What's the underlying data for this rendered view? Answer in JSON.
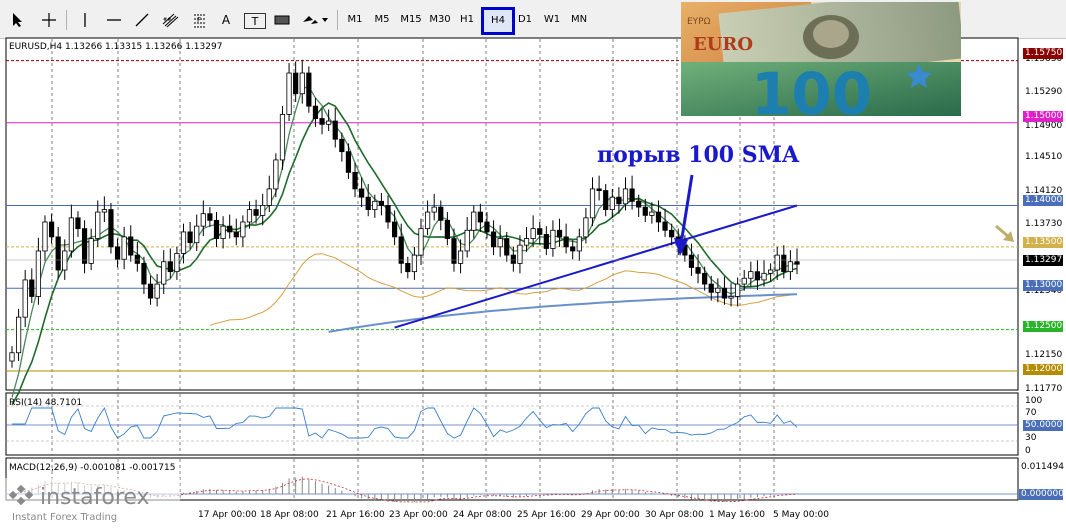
{
  "toolbar": {
    "timeframes": [
      "M1",
      "M5",
      "M15",
      "M30",
      "H1",
      "H4",
      "D1",
      "W1",
      "MN"
    ],
    "active_timeframe": "H4",
    "tools": [
      "cursor-tool",
      "crosshair-tool",
      "vertical-line-tool",
      "horizontal-line-tool",
      "trendline-tool",
      "channel-tool",
      "fibonacci-tool",
      "text-tool",
      "text-label-tool",
      "rectangle-tool",
      "shapes-dropdown"
    ],
    "text_tool_label": "A",
    "text_label_tool_label": "T"
  },
  "chart": {
    "title": "EURUSD,H4  1.13266 1.13315 1.13266 1.13297",
    "annotation": "порыв 100 SMA",
    "current_price": "1.13297",
    "price_axis_labels": [
      "1.15830",
      "1.15290",
      "1.14900",
      "1.14510",
      "1.14120",
      "1.13730",
      "1.12540",
      "1.12150",
      "1.11770"
    ],
    "level_labels": [
      {
        "value": "1.15750",
        "color": "#8b0000"
      },
      {
        "value": "1.15000",
        "color": "#e020c8"
      },
      {
        "value": "1.14000",
        "color": "#4a6fb8"
      },
      {
        "value": "1.13500",
        "color": "#d4b04a"
      },
      {
        "value": "1.13000",
        "color": "#4a6fb8"
      },
      {
        "value": "1.12500",
        "color": "#28b428"
      },
      {
        "value": "1.12000",
        "color": "#b48c00"
      }
    ],
    "time_labels": [
      "17 Apr 00:00",
      "18 Apr 08:00",
      "21 Apr 16:00",
      "23 Apr 00:00",
      "24 Apr 08:00",
      "25 Apr 16:00",
      "29 Apr 00:00",
      "30 Apr 08:00",
      "1 May 16:00",
      "5 May 00:00"
    ],
    "colors": {
      "bull": "#ffffff",
      "bear": "#000000",
      "sma100": "#1a1acc",
      "ma_fast": "#4a8a5a",
      "ma_slow": "#1f6b2a",
      "ma_orange": "#d4a040",
      "ma_light_blue": "#6a8fcc",
      "arrow": "#1a1acc",
      "side_arrow": "#bfae6a"
    }
  },
  "rsi": {
    "title": "RSI(14) 48.7101",
    "levels": [
      "100",
      "70",
      "50.0000",
      "30",
      "0"
    ]
  },
  "macd": {
    "title": "MACD(12,26,9) -0.001081 -0.001715",
    "levels": [
      "0.011494",
      "0.000000"
    ]
  },
  "logo": {
    "brand": "instaforex",
    "tagline": "Instant Forex Trading"
  },
  "banner": {
    "text_euro": "EURO",
    "text_100": "100",
    "text_ero": "EYPΩ"
  }
}
